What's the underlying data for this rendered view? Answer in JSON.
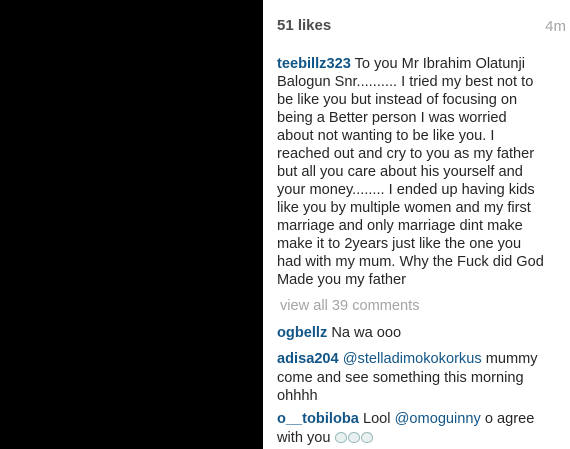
{
  "post": {
    "likes": "51 likes",
    "time": "4m",
    "caption_user": "teebillz323",
    "caption_lines": [
      "To you Mr Ibrahim Olatunji",
      "Balogun Snr.......... I tried my best not to",
      "be like you but instead of focusing on",
      "being a Better person I was worried",
      "about not wanting to be like you. I",
      "reached out and cry to you as my father",
      "but all you care about his yourself and",
      "your money........ I ended up having kids",
      "like you by multiple women and my first",
      "marriage and only marriage dint make",
      "make it to 2years just like the one you",
      "had with my mum. Why the Fuck did God",
      "Made you my father"
    ],
    "view_all": "view all 39 comments"
  },
  "comments": [
    {
      "user": "ogbellz",
      "text": "Na wa ooo"
    },
    {
      "user": "adisa204",
      "mention": "@stelladimokokorkus",
      "text_after": "mummy",
      "line2": "come and see something this morning",
      "line3": "ohhhh"
    },
    {
      "user": "o__tobiloba",
      "text_before": "Lool",
      "mention": "@omoguinny",
      "text_after": "o agree",
      "line2": "with you",
      "emoji": [
        "grinning-cat-icon",
        "grinning-cat-icon",
        "grinning-cat-icon"
      ]
    }
  ]
}
